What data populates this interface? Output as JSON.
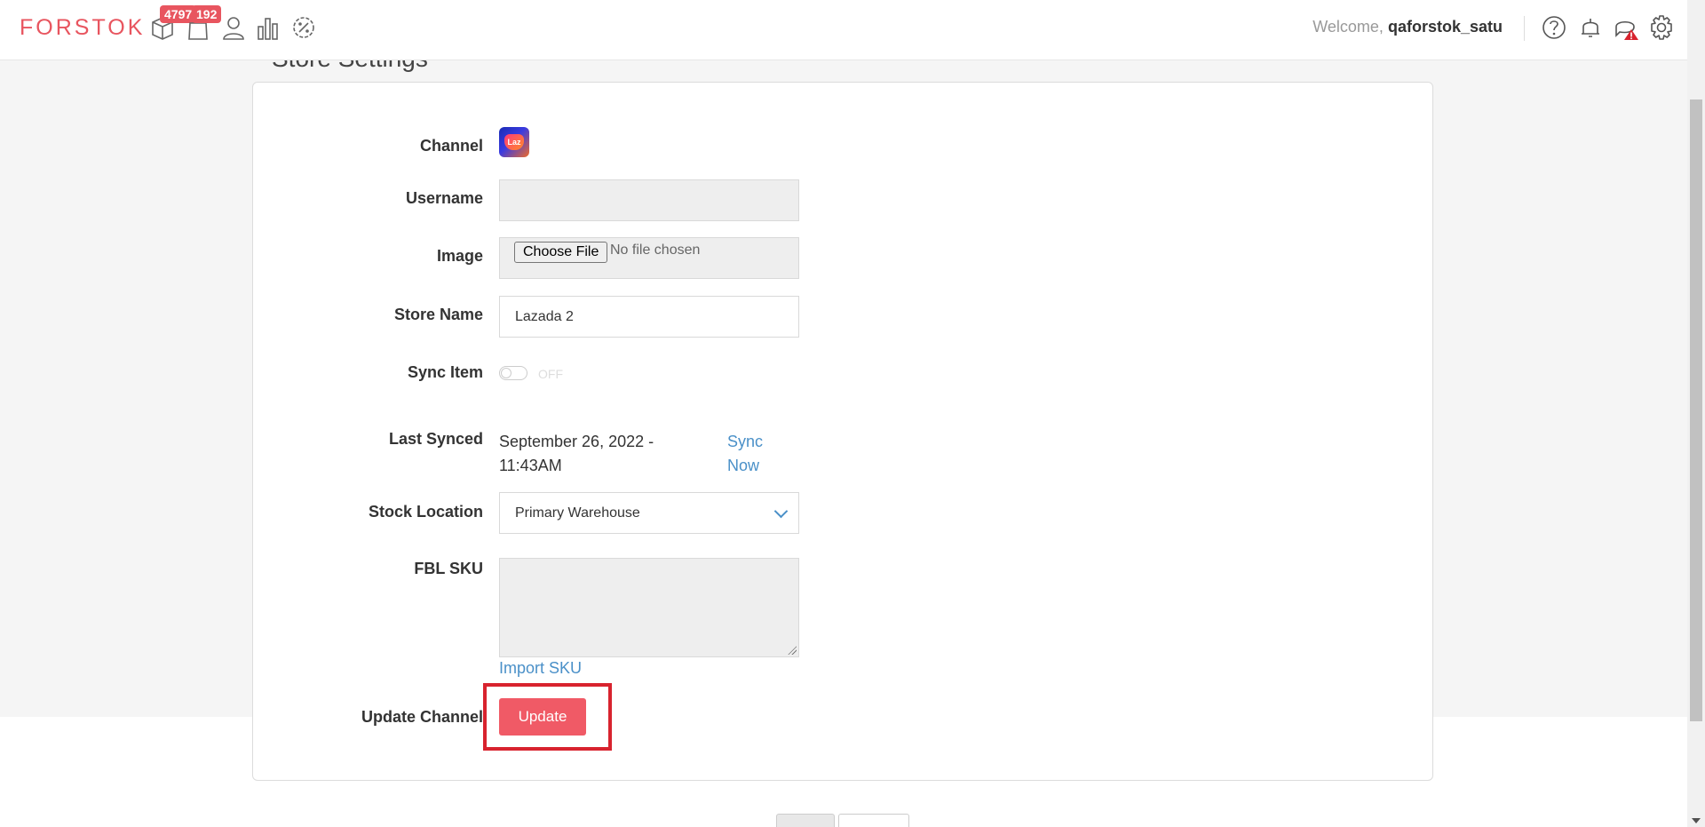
{
  "header": {
    "logo": "FORSTOK",
    "badges": [
      "4797",
      "192"
    ],
    "welcome_prefix": "Welcome,",
    "username": "qaforstok_satu",
    "nav_icons": [
      "box-icon",
      "bag-icon",
      "user-icon",
      "bar-chart-icon",
      "discount-icon"
    ],
    "right_icons": [
      "help-icon",
      "bell-icon",
      "alert-icon",
      "gear-icon"
    ]
  },
  "page": {
    "title": "Store Settings"
  },
  "form": {
    "channel_label": "Channel",
    "channel_logo_text": "Laz",
    "username_label": "Username",
    "username_value": "",
    "image_label": "Image",
    "choose_file": "Choose File",
    "no_file": "No file chosen",
    "store_name_label": "Store Name",
    "store_name_value": "Lazada 2",
    "sync_item_label": "Sync Item",
    "sync_item_state": "OFF",
    "last_synced_label": "Last Synced",
    "last_synced_value": "September 26, 2022 - 11:43AM",
    "sync_now": "Sync Now",
    "stock_location_label": "Stock Location",
    "stock_location_value": "Primary Warehouse",
    "fbl_sku_label": "FBL SKU",
    "fbl_sku_value": "",
    "import_sku": "Import SKU",
    "update_channel_label": "Update Channel",
    "update_button": "Update"
  },
  "colors": {
    "brand": "#e8555f",
    "link": "#4a90c8",
    "button": "#f05a66",
    "highlight": "#d8232e"
  }
}
